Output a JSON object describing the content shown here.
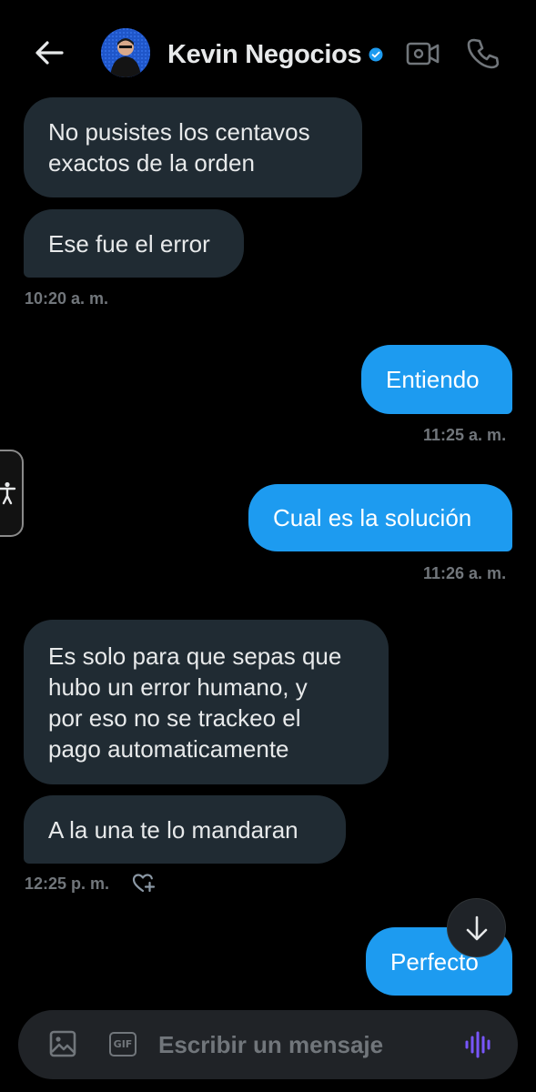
{
  "header": {
    "contact_name": "Kevin Negocios",
    "back_icon": "arrow-left-icon",
    "verified_icon": "verified-badge-icon",
    "video_icon": "video-camera-icon",
    "call_icon": "phone-icon",
    "accent": "#1d9bf0"
  },
  "messages": [
    {
      "side": "incoming",
      "lines": [
        "No pusistes los centavos",
        "exactos de la orden"
      ]
    },
    {
      "side": "incoming",
      "lines": [
        "Ese fue el error"
      ],
      "time": "10:20 a. m."
    },
    {
      "side": "outgoing",
      "lines": [
        "Entiendo"
      ],
      "time": "11:25 a. m."
    },
    {
      "side": "outgoing",
      "lines": [
        "Cual es la solución"
      ],
      "time": "11:26 a. m."
    },
    {
      "side": "incoming",
      "lines": [
        "Es solo para que sepas que",
        "hubo un error humano, y",
        "por eso no se trackeo el",
        "pago automaticamente"
      ]
    },
    {
      "side": "incoming",
      "lines": [
        "A la una te lo mandaran"
      ],
      "time": "12:25 p. m."
    },
    {
      "side": "outgoing",
      "lines": [
        "Perfecto"
      ]
    }
  ],
  "composer": {
    "placeholder": "Escribir un mensaje",
    "gif_label": "GIF",
    "image_icon": "image-icon",
    "voice_icon": "voice-waveform-icon"
  },
  "colors": {
    "incoming_bubble": "#202b33",
    "outgoing_bubble": "#1d9bf0",
    "timestamp": "#71767b",
    "voice_accent": "#7856ff"
  }
}
